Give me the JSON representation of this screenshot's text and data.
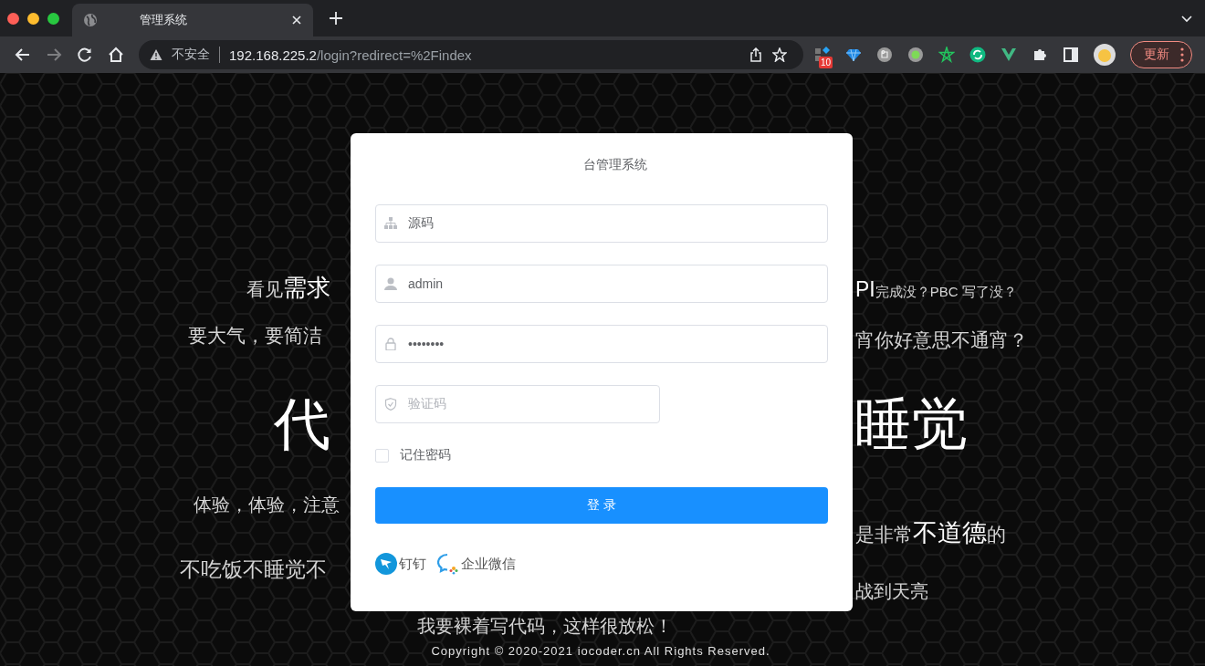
{
  "browser": {
    "tab": {
      "title": "管理系统",
      "selected": true
    },
    "address": {
      "security": "不安全",
      "host": "192.168.225.2",
      "path": "/login?redirect=%2Findex"
    },
    "extension_badge": "10",
    "update_button": "更新"
  },
  "slogans": [
    {
      "segments": [
        {
          "text": "看见",
          "emphasis": false
        },
        {
          "text": "需求",
          "emphasis": true
        }
      ]
    },
    {
      "segments": [
        {
          "text": "要大气，要简洁",
          "emphasis": false
        }
      ]
    },
    {
      "segments": [
        {
          "text": "代",
          "emphasis": true
        }
      ]
    },
    {
      "segments": [
        {
          "text": "体验，体验，注意",
          "emphasis": false
        }
      ]
    },
    {
      "segments": [
        {
          "text": "不吃饭不睡觉不",
          "emphasis": false
        }
      ]
    },
    {
      "segments": [
        {
          "text": "PI",
          "emphasis": true
        },
        {
          "text": "完成没？PBC 写了没？",
          "emphasis": false
        }
      ]
    },
    {
      "segments": [
        {
          "text": "宵你好意思不通宵？",
          "emphasis": false
        }
      ]
    },
    {
      "segments": [
        {
          "text": "睡觉",
          "emphasis": true
        }
      ]
    },
    {
      "segments": [
        {
          "text": "是非常",
          "emphasis": false
        },
        {
          "text": "不道德",
          "emphasis": true
        },
        {
          "text": "的",
          "emphasis": false
        }
      ]
    },
    {
      "segments": [
        {
          "text": "战到天亮",
          "emphasis": false
        }
      ]
    },
    {
      "segments": [
        {
          "text": "我要裸着写代码，这样很放松！",
          "emphasis": false
        }
      ]
    }
  ],
  "login": {
    "title": "台管理系统",
    "fields": [
      {
        "kind": "tenant",
        "value": "源码"
      },
      {
        "kind": "user",
        "value": "admin"
      },
      {
        "kind": "password",
        "value": "••••••••"
      },
      {
        "kind": "captcha",
        "placeholder": "验证码"
      }
    ],
    "remember": {
      "label": "记住密码",
      "checked": false
    },
    "submit": "登 录",
    "social": [
      {
        "kind": "dingtalk",
        "label": "钉钉"
      },
      {
        "kind": "wecom",
        "label": "企业微信"
      }
    ]
  },
  "copyright": "Copyright © 2020-2021 iocoder.cn All Rights Reserved."
}
